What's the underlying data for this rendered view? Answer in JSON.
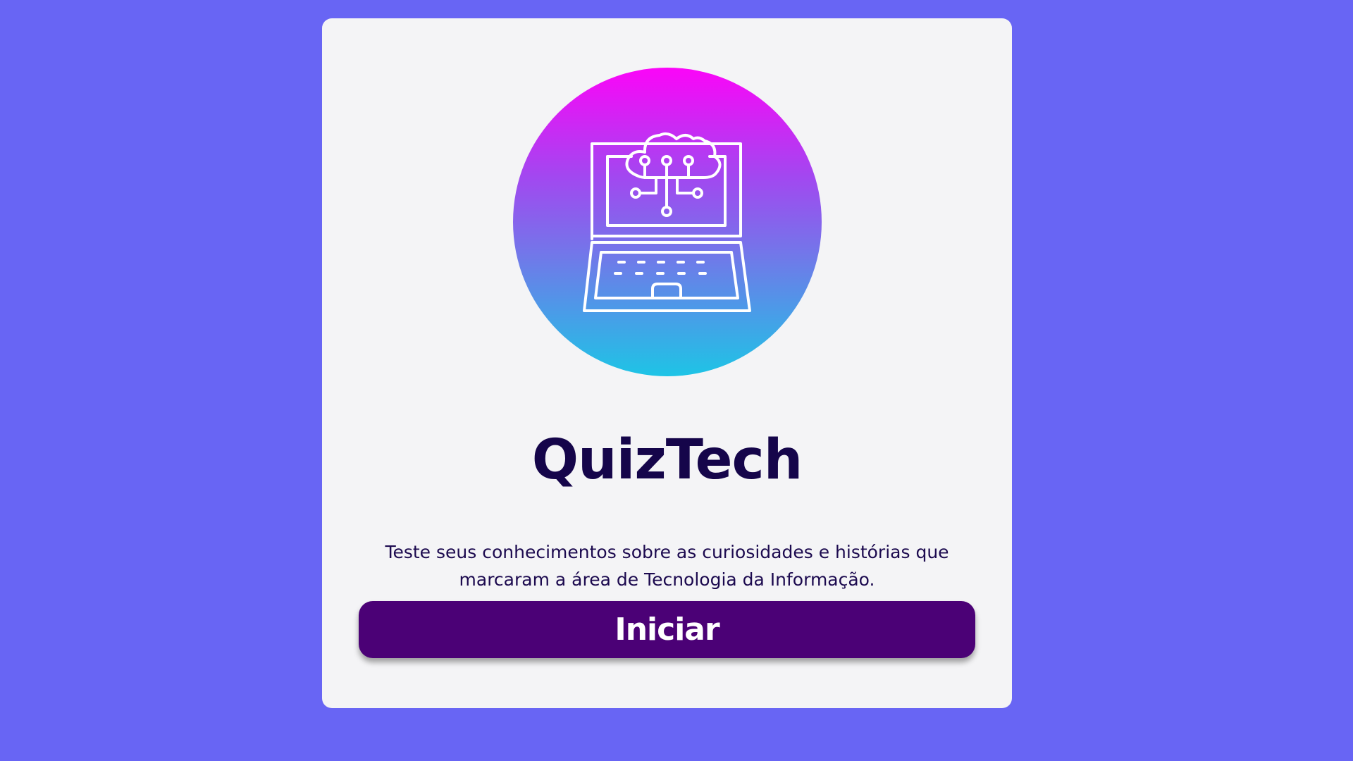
{
  "app": {
    "title": "QuizTech",
    "description": "Teste seus conhecimentos sobre as curiosidades e histórias que marcaram a área de Tecnologia da Informação.",
    "start_label": "Iniciar"
  },
  "hero": {
    "icon": "laptop-cloud-circuit-icon"
  },
  "colors": {
    "background": "#6865f4",
    "card": "#f4f4f6",
    "title": "#15054a",
    "button": "#4b0176",
    "gradient_top": "#fb05f8",
    "gradient_bottom": "#1ec4e6"
  }
}
